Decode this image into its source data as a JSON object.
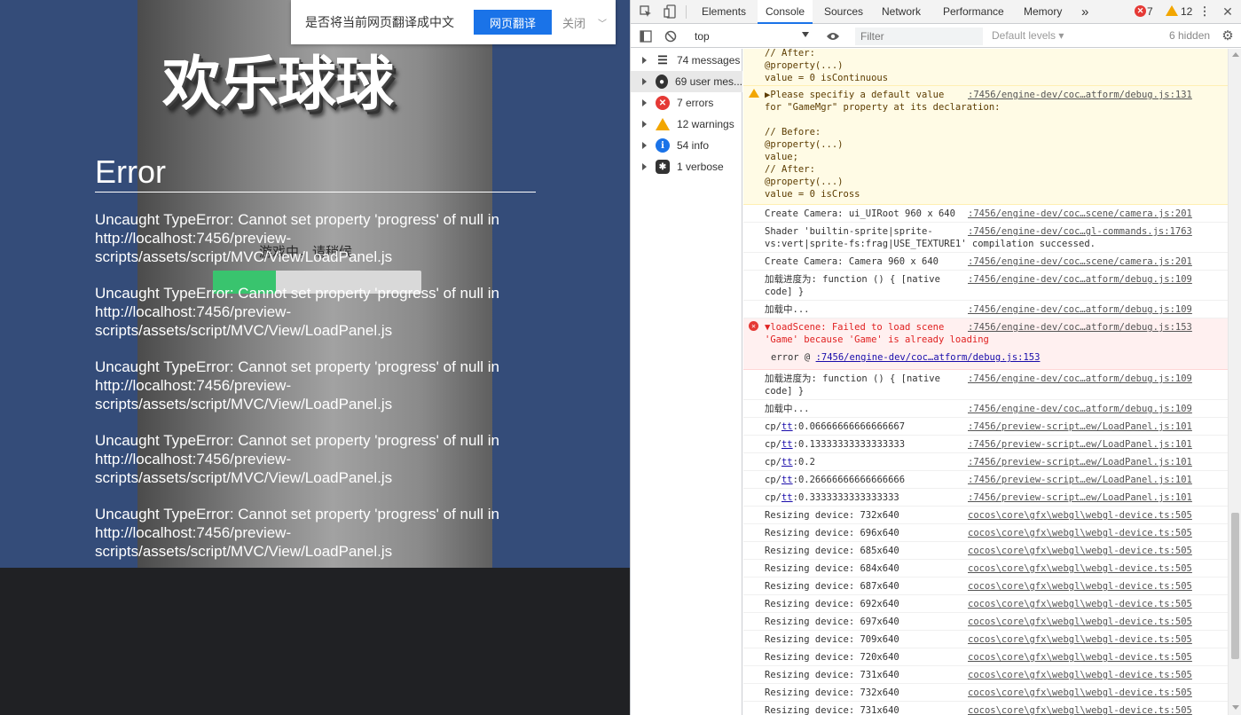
{
  "game": {
    "title": "欢乐球球",
    "loading_label": "游戏中，请稍候",
    "progress": 0.3,
    "error": {
      "heading": "Error",
      "messages": [
        "Uncaught TypeError: Cannot set property 'progress' of null in http://localhost:7456/preview-scripts/assets/script/MVC/View/LoadPanel.js",
        "Uncaught TypeError: Cannot set property 'progress' of null in http://localhost:7456/preview-scripts/assets/script/MVC/View/LoadPanel.js",
        "Uncaught TypeError: Cannot set property 'progress' of null in http://localhost:7456/preview-scripts/assets/script/MVC/View/LoadPanel.js",
        "Uncaught TypeError: Cannot set property 'progress' of null in http://localhost:7456/preview-scripts/assets/script/MVC/View/LoadPanel.js",
        "Uncaught TypeError: Cannot set property 'progress' of null in http://localhost:7456/preview-scripts/assets/script/MVC/View/LoadPanel.js"
      ]
    }
  },
  "translate_bar": {
    "prompt": "是否将当前网页翻译成中文",
    "translate_label": "网页翻译",
    "close_label": "关闭",
    "dropdown_icon": "chevron-down-icon"
  },
  "devtools": {
    "tabs": [
      "Elements",
      "Console",
      "Sources",
      "Network",
      "Performance",
      "Memory"
    ],
    "active_tab": "Console",
    "more_tabs_icon": "»",
    "error_count": "7",
    "warning_count": "12",
    "context": "top",
    "filter_placeholder": "Filter",
    "levels_label": "Default levels ▾",
    "hidden_count": "6 hidden",
    "sidebar": [
      {
        "label": "74 messages",
        "icon": "list-icon"
      },
      {
        "label": "69 user mes...",
        "icon": "user-icon"
      },
      {
        "label": "7 errors",
        "icon": "error-icon"
      },
      {
        "label": "12 warnings",
        "icon": "warning-icon"
      },
      {
        "label": "54 info",
        "icon": "info-icon"
      },
      {
        "label": "1 verbose",
        "icon": "bug-icon"
      }
    ],
    "console_rows": {
      "warn_tail": {
        "msg": "// After:\n@property(...)\nvalue = 0 isContinuous"
      },
      "warn_gamemgr": {
        "msg": "▶Please specifiy a default value\nfor \"GameMgr\" property at its declaration:\n\n// Before:\n@property(...)\nvalue;\n// After:\n@property(...)\nvalue = 0 isCross",
        "src": ":7456/engine-dev/coc…atform/debug.js:131"
      },
      "cam1": {
        "msg": "Create Camera: ui_UIRoot 960 x 640",
        "src": ":7456/engine-dev/coc…scene/camera.js:201"
      },
      "shader": {
        "msg": "Shader 'builtin-sprite|sprite-\nvs:vert|sprite-fs:frag|USE_TEXTURE1' compilation successed.",
        "src": ":7456/engine-dev/coc…gl-commands.js:1763"
      },
      "cam2": {
        "msg": "Create Camera: Camera 960 x 640",
        "src": ":7456/engine-dev/coc…scene/camera.js:201"
      },
      "progress1": {
        "msg": "加载进度为: function () { [native\ncode] }",
        "src": ":7456/engine-dev/coc…atform/debug.js:109"
      },
      "loading1": {
        "msg": "加载中...",
        "src": ":7456/engine-dev/coc…atform/debug.js:109"
      },
      "err_loadscene": {
        "msg": "▼loadScene: Failed to load scene\n'Game' because 'Game' is already loading",
        "src": ":7456/engine-dev/coc…atform/debug.js:153",
        "stack_prefix": "error @ ",
        "stack_link": ":7456/engine-dev/coc…atform/debug.js:153"
      },
      "progress2": {
        "msg": "加载进度为: function () { [native\ncode] }",
        "src": ":7456/engine-dev/coc…atform/debug.js:109"
      },
      "loading2": {
        "msg": "加载中...",
        "src": ":7456/engine-dev/coc…atform/debug.js:109"
      },
      "cp": [
        {
          "prefix": "cp/",
          "link": "tt",
          "value": ":0.06666666666666667",
          "src": ":7456/preview-script…ew/LoadPanel.js:101"
        },
        {
          "prefix": "cp/",
          "link": "tt",
          "value": ":0.13333333333333333",
          "src": ":7456/preview-script…ew/LoadPanel.js:101"
        },
        {
          "prefix": "cp/",
          "link": "tt",
          "value": ":0.2",
          "src": ":7456/preview-script…ew/LoadPanel.js:101"
        },
        {
          "prefix": "cp/",
          "link": "tt",
          "value": ":0.26666666666666666",
          "src": ":7456/preview-script…ew/LoadPanel.js:101"
        },
        {
          "prefix": "cp/",
          "link": "tt",
          "value": ":0.3333333333333333",
          "src": ":7456/preview-script…ew/LoadPanel.js:101"
        }
      ],
      "resize": [
        {
          "msg": "Resizing device: 732x640",
          "src": "cocos\\core\\gfx\\webgl\\webgl-device.ts:505"
        },
        {
          "msg": "Resizing device: 696x640",
          "src": "cocos\\core\\gfx\\webgl\\webgl-device.ts:505"
        },
        {
          "msg": "Resizing device: 685x640",
          "src": "cocos\\core\\gfx\\webgl\\webgl-device.ts:505"
        },
        {
          "msg": "Resizing device: 684x640",
          "src": "cocos\\core\\gfx\\webgl\\webgl-device.ts:505"
        },
        {
          "msg": "Resizing device: 687x640",
          "src": "cocos\\core\\gfx\\webgl\\webgl-device.ts:505"
        },
        {
          "msg": "Resizing device: 692x640",
          "src": "cocos\\core\\gfx\\webgl\\webgl-device.ts:505"
        },
        {
          "msg": "Resizing device: 697x640",
          "src": "cocos\\core\\gfx\\webgl\\webgl-device.ts:505"
        },
        {
          "msg": "Resizing device: 709x640",
          "src": "cocos\\core\\gfx\\webgl\\webgl-device.ts:505"
        },
        {
          "msg": "Resizing device: 720x640",
          "src": "cocos\\core\\gfx\\webgl\\webgl-device.ts:505"
        },
        {
          "msg": "Resizing device: 731x640",
          "src": "cocos\\core\\gfx\\webgl\\webgl-device.ts:505"
        },
        {
          "msg": "Resizing device: 732x640",
          "src": "cocos\\core\\gfx\\webgl\\webgl-device.ts:505"
        },
        {
          "msg": "Resizing device: 731x640",
          "src": "cocos\\core\\gfx\\webgl\\webgl-device.ts:505"
        }
      ]
    }
  }
}
